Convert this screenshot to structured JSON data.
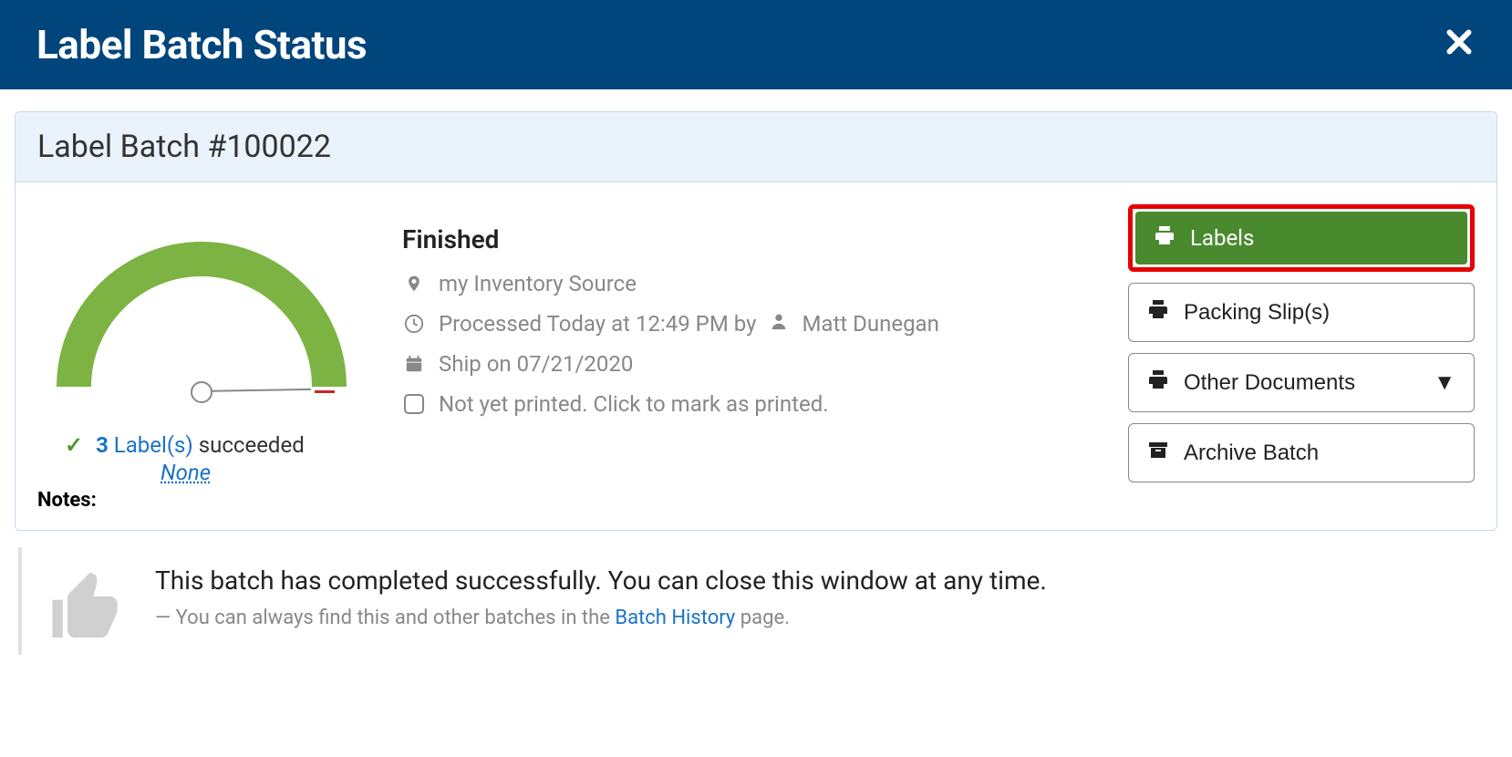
{
  "header": {
    "title": "Label Batch Status"
  },
  "panel": {
    "title": "Label Batch #100022"
  },
  "gauge": {
    "succeeded_count": "3",
    "succeeded_label": "Label(s)",
    "succeeded_suffix": "succeeded",
    "none_link": "None",
    "notes_label": "Notes:"
  },
  "info": {
    "status": "Finished",
    "location": "my Inventory Source",
    "processed_prefix": "Processed Today at 12:49 PM by",
    "processed_by": "Matt Dunegan",
    "ship_on": "Ship on 07/21/2020",
    "printed": "Not yet printed. Click to mark as printed."
  },
  "actions": {
    "labels": "Labels",
    "packing": "Packing Slip(s)",
    "other": "Other Documents",
    "archive": "Archive Batch"
  },
  "footer": {
    "headline": "This batch has completed successfully. You can close this window at any time.",
    "sub_prefix": "— You can always find this and other batches in the ",
    "link": "Batch History",
    "sub_suffix": " page."
  }
}
